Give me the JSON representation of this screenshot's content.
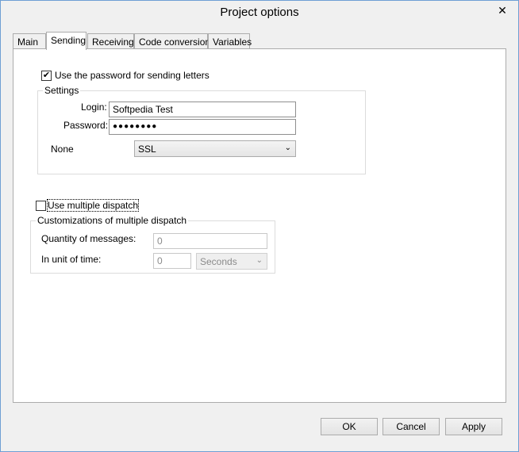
{
  "window": {
    "title": "Project options",
    "close_glyph": "✕"
  },
  "tabs": [
    {
      "label": "Main"
    },
    {
      "label": "Sending",
      "active": true
    },
    {
      "label": "Receiving"
    },
    {
      "label": "Code conversion"
    },
    {
      "label": "Variables"
    }
  ],
  "sending": {
    "use_password": {
      "label": "Use the password for sending letters",
      "checked": true,
      "check_glyph": "✔"
    },
    "settings": {
      "legend": "Settings",
      "login_label": "Login:",
      "login_value": "Softpedia Test",
      "password_label": "Password:",
      "password_value": "●●●●●●●●",
      "security_label": "None",
      "security_value": "SSL"
    },
    "multiple_dispatch": {
      "label": "Use multiple dispatch",
      "checked": false,
      "legend": "Customizations of multiple dispatch",
      "quantity_label": "Quantity of messages:",
      "quantity_value": "0",
      "unit_label": "In unit of time:",
      "unit_value": "0",
      "unit_select": "Seconds"
    }
  },
  "buttons": {
    "ok": "OK",
    "cancel": "Cancel",
    "apply": "Apply"
  },
  "icons": {
    "chevron": "⌄"
  }
}
